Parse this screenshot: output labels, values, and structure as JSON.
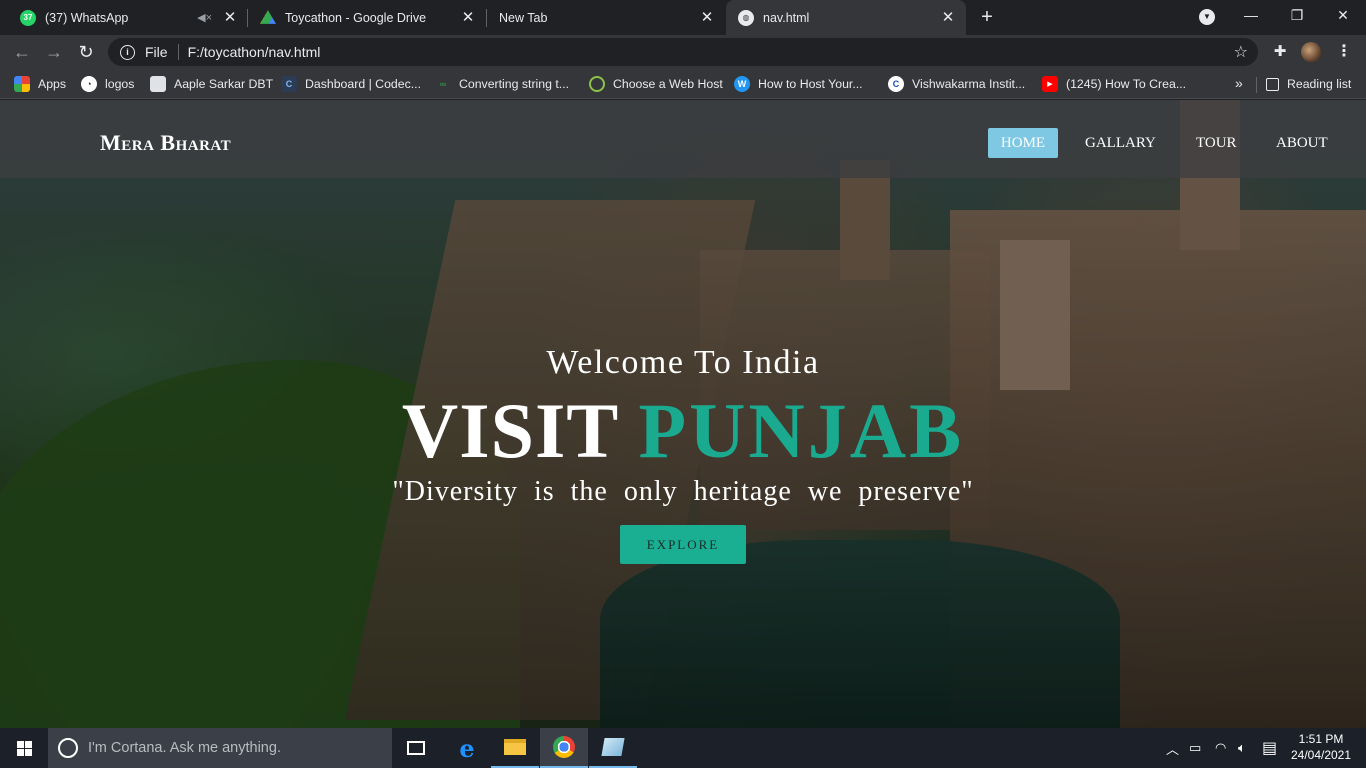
{
  "browser": {
    "tabs": [
      {
        "label": "(37) WhatsApp",
        "icon": "whatsapp-icon",
        "badge": "37"
      },
      {
        "label": "Toycathon - Google Drive",
        "icon": "google-drive-icon"
      },
      {
        "label": "New Tab",
        "icon": ""
      },
      {
        "label": "nav.html",
        "icon": "globe-icon",
        "active": true
      }
    ],
    "address": {
      "scheme_label": "File",
      "url": "F:/toycathon/nav.html"
    },
    "bookmarks": [
      {
        "label": "Apps",
        "icon": "apps-grid-icon"
      },
      {
        "label": "logos",
        "icon": "logos-icon"
      },
      {
        "label": "Aaple Sarkar DBT",
        "icon": "document-icon"
      },
      {
        "label": "Dashboard | Codec...",
        "icon": "codec-icon"
      },
      {
        "label": "Converting string t...",
        "icon": "code-icon"
      },
      {
        "label": "Choose a Web Host",
        "icon": "webhost-icon"
      },
      {
        "label": "How to Host Your...",
        "icon": "wordpress-icon"
      },
      {
        "label": "Vishwakarma Instit...",
        "icon": "college-icon"
      },
      {
        "label": "(1245) How To Crea...",
        "icon": "youtube-icon"
      }
    ],
    "reading_list": "Reading list"
  },
  "site": {
    "brand": "Mera Bharat",
    "nav": [
      {
        "label": "HOME",
        "active": true
      },
      {
        "label": "GALLARY",
        "active": false
      },
      {
        "label": "TOUR",
        "active": false
      },
      {
        "label": "ABOUT",
        "active": false
      }
    ],
    "hero": {
      "subtitle": "Welcome To India",
      "title_part1": "VISIT",
      "title_part2": "PUNJAB",
      "quote": "\"Diversity is the only heritage we preserve\"",
      "cta": "EXPLORE"
    },
    "colors": {
      "accent": "#1aaa8f",
      "nav_active": "#7ec8e3",
      "button": "#1aae92"
    }
  },
  "taskbar": {
    "search_placeholder": "I'm Cortana. Ask me anything.",
    "time": "1:51 PM",
    "date": "24/04/2021"
  }
}
